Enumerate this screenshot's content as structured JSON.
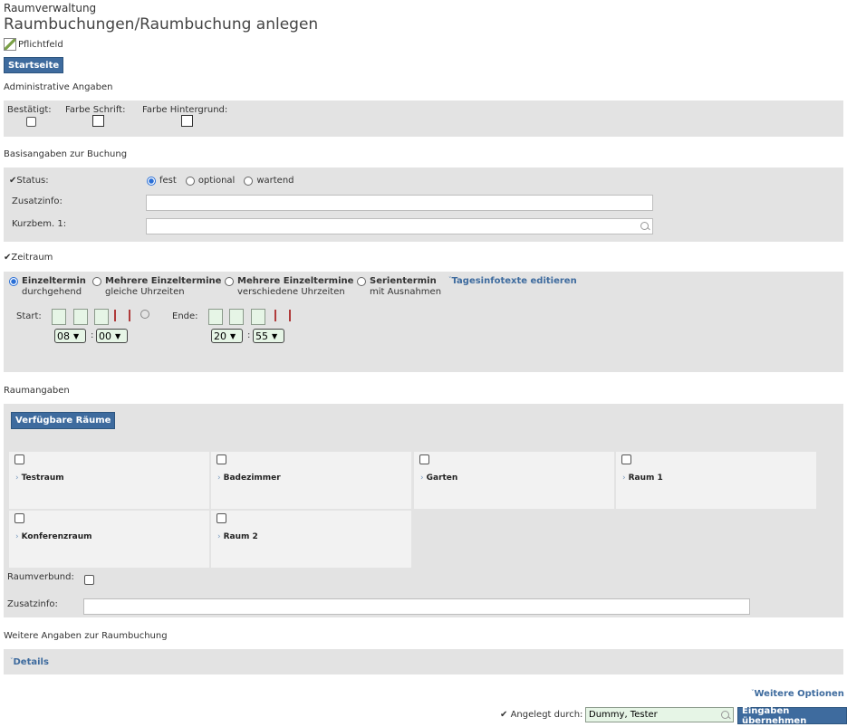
{
  "header": {
    "module": "Raumverwaltung",
    "title": "Raumbuchungen/Raumbuchung anlegen",
    "legend_label": "Pflichtfeld",
    "home_button": "Startseite"
  },
  "admin": {
    "section_label": "Administrative Angaben",
    "confirmed_label": "Bestätigt:",
    "font_color_label": "Farbe Schrift:",
    "bg_color_label": "Farbe Hintergrund:"
  },
  "basis": {
    "section_label": "Basisangaben zur Buchung",
    "status_label": "Status:",
    "status_options": [
      "fest",
      "optional",
      "wartend"
    ],
    "status_selected": "fest",
    "extra_label": "Zusatzinfo:",
    "extra_value": "",
    "short_label": "Kurzbem. 1:",
    "short_value": ""
  },
  "zeitraum": {
    "section_label": "Zeitraum",
    "options": [
      {
        "title": "Einzeltermin",
        "sub": "durchgehend",
        "selected": true
      },
      {
        "title": "Mehrere Einzeltermine",
        "sub": "gleiche Uhrzeiten",
        "selected": false
      },
      {
        "title": "Mehrere Einzeltermine",
        "sub": "verschiedene Uhrzeiten",
        "selected": false
      },
      {
        "title": "Serientermin",
        "sub": "mit Ausnahmen",
        "selected": false
      }
    ],
    "infotext_link": "Tagesinfotexte editieren",
    "start_label": "Start:",
    "end_label": "Ende:",
    "start_hour": "08",
    "start_minute": "00",
    "end_hour": "20",
    "end_minute": "55",
    "time_sep": ":"
  },
  "raum": {
    "section_label": "Raumangaben",
    "available_button": "Verfügbare Räume",
    "rooms": [
      "Testraum",
      "Badezimmer",
      "Garten",
      "Raum 1",
      "Konferenzraum",
      "Raum 2"
    ],
    "verbund_label": "Raumverbund:",
    "extra_label": "Zusatzinfo:",
    "extra_value": ""
  },
  "weitere": {
    "section_label": "Weitere Angaben zur Raumbuchung",
    "details_link": "Details",
    "more_options_link": "Weitere Optionen"
  },
  "footer": {
    "created_by_label": "Angelegt durch:",
    "created_by_value": "Dummy, Tester",
    "submit_button": "Eingaben übernehmen"
  },
  "colors": {
    "accent": "#3e6b9e",
    "panel": "#e3e3e3",
    "field_green": "#e6f5e6"
  }
}
